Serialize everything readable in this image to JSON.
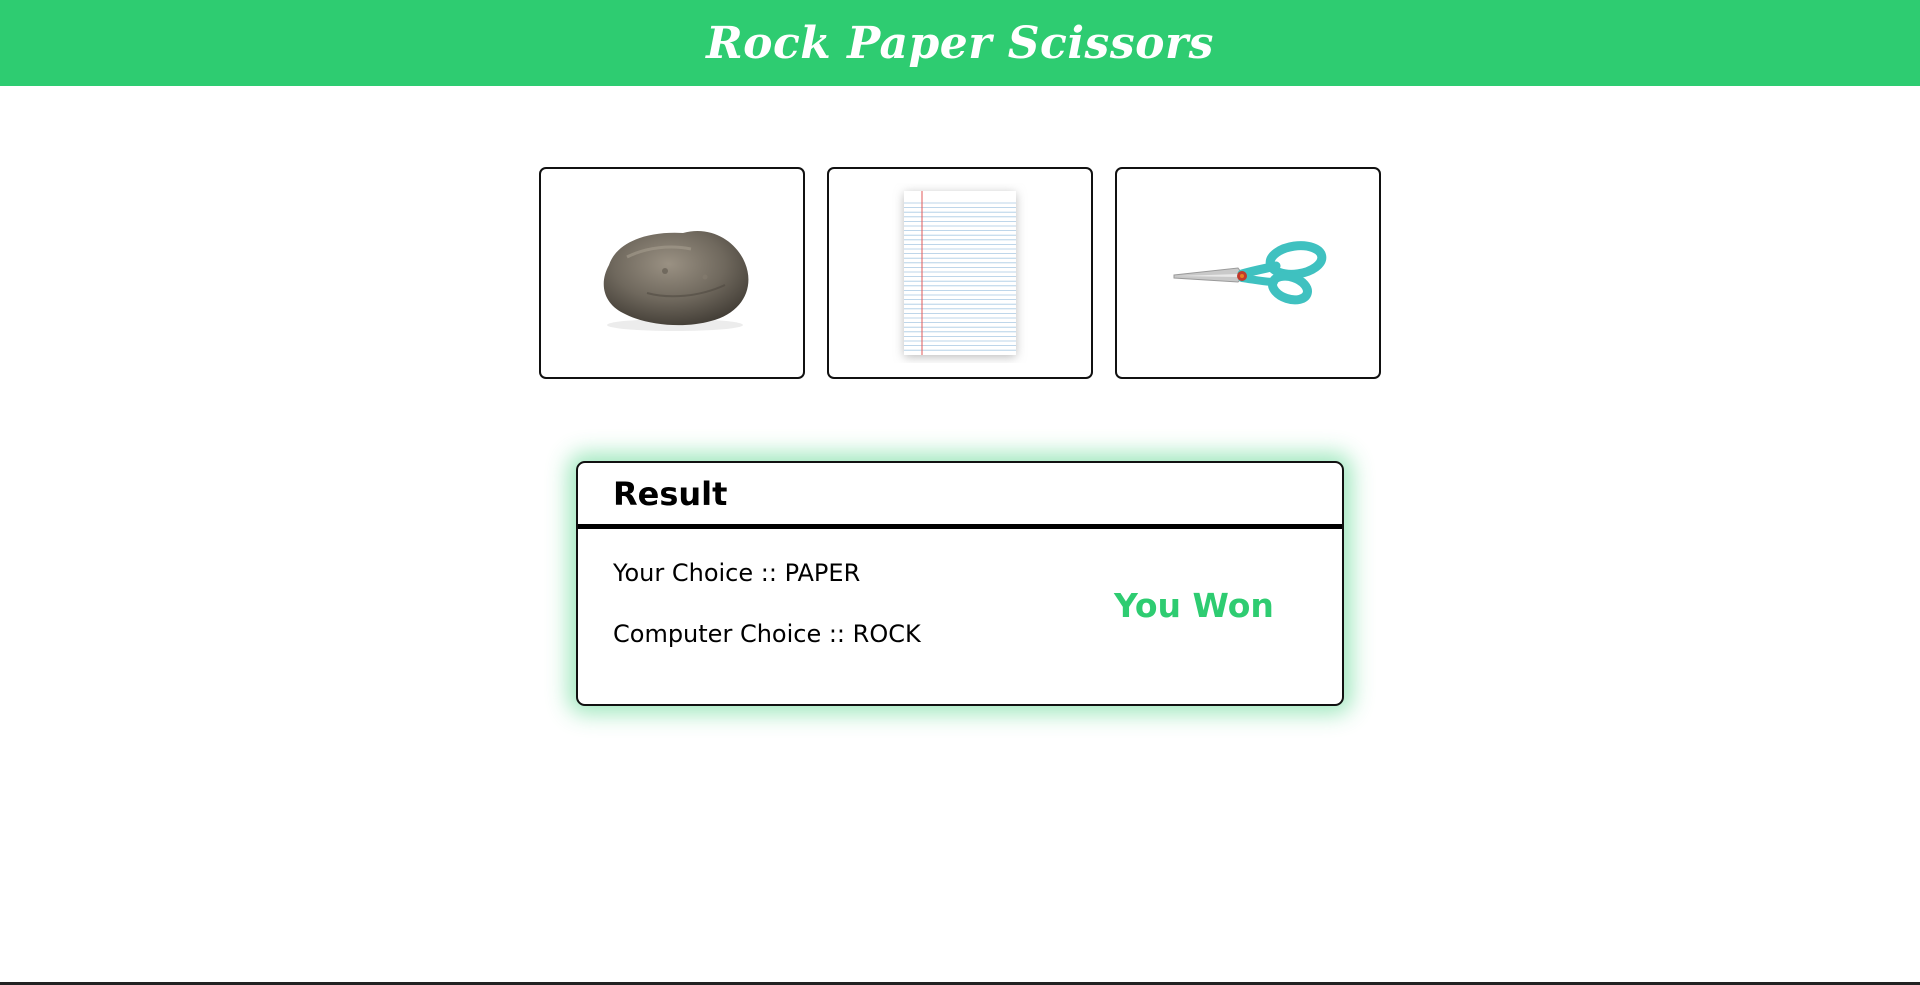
{
  "header": {
    "title": "Rock Paper Scissors",
    "background": "#2ecc71"
  },
  "choices": [
    {
      "id": "rock",
      "icon": "rock-icon"
    },
    {
      "id": "paper",
      "icon": "paper-icon"
    },
    {
      "id": "scissors",
      "icon": "scissors-icon"
    }
  ],
  "result": {
    "title": "Result",
    "your_choice": "Your Choice :: PAPER",
    "computer_choice": "Computer Choice :: ROCK",
    "outcome": "You Won",
    "outcome_color": "#2ecc71"
  }
}
